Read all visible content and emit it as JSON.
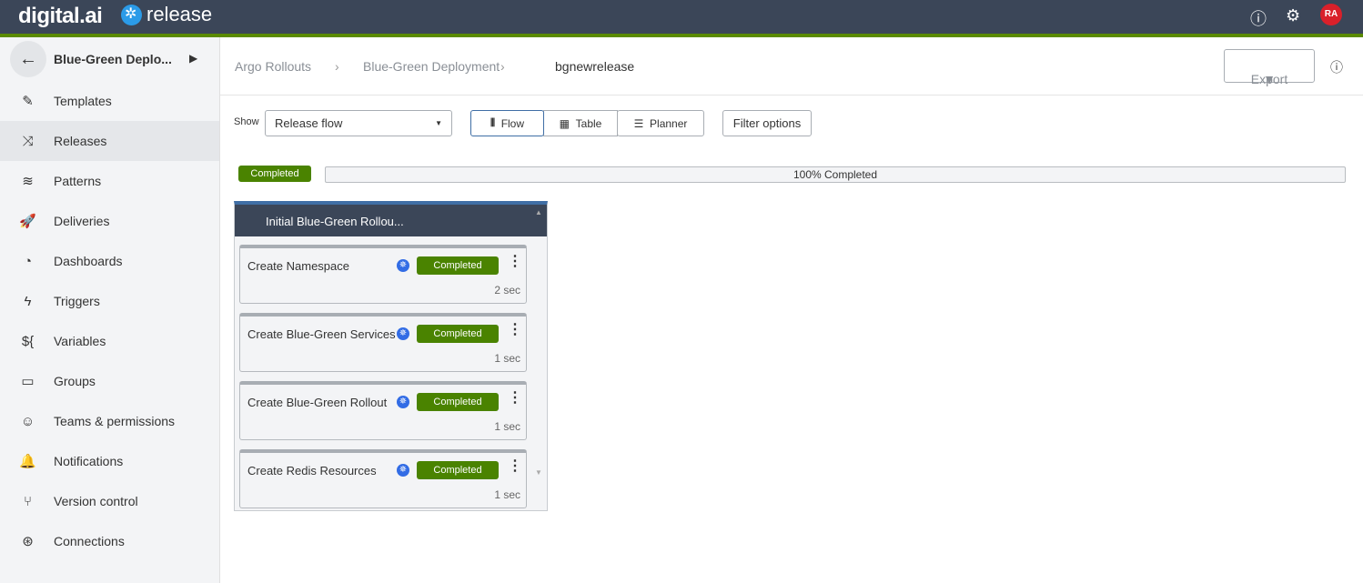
{
  "header": {
    "brand": "digital.ai",
    "product": "release",
    "avatar": "RA",
    "icons": [
      "help-icon",
      "gear-icon"
    ]
  },
  "sidebar": {
    "title": "Blue-Green Deplo...",
    "items": [
      {
        "label": "Templates",
        "icon": "✎"
      },
      {
        "label": "Releases",
        "icon": "⤨",
        "active": true
      },
      {
        "label": "Patterns",
        "icon": "≋"
      },
      {
        "label": "Deliveries",
        "icon": "🚀"
      },
      {
        "label": "Dashboards",
        "icon": "◔"
      },
      {
        "label": "Triggers",
        "icon": "ϟ"
      },
      {
        "label": "Variables",
        "icon": "${"
      },
      {
        "label": "Groups",
        "icon": "▭"
      },
      {
        "label": "Teams & permissions",
        "icon": "☺"
      },
      {
        "label": "Notifications",
        "icon": "🔔"
      },
      {
        "label": "Version control",
        "icon": "⑂"
      },
      {
        "label": "Connections",
        "icon": "⊛"
      }
    ]
  },
  "breadcrumb": [
    "Argo Rollouts",
    "Blue-Green Deployment",
    "bgnewrelease"
  ],
  "export_label": "Export",
  "toolbar": {
    "show_label": "Show",
    "show_value": "Release flow",
    "views": [
      "Flow",
      "Table",
      "Planner"
    ],
    "active_view": "Flow",
    "filter_label": "Filter options"
  },
  "status": {
    "badge": "Completed",
    "progress_text": "100% Completed",
    "progress": 100,
    "color": "#4a8300"
  },
  "phase": {
    "title": "Initial Blue-Green Rollou...",
    "tasks": [
      {
        "name": "Create Namespace",
        "status": "Completed",
        "duration": "2 sec"
      },
      {
        "name": "Create Blue-Green Services",
        "status": "Completed",
        "duration": "1 sec"
      },
      {
        "name": "Create Blue-Green Rollout",
        "status": "Completed",
        "duration": "1 sec"
      },
      {
        "name": "Create Redis Resources",
        "status": "Completed",
        "duration": "1 sec"
      }
    ]
  }
}
